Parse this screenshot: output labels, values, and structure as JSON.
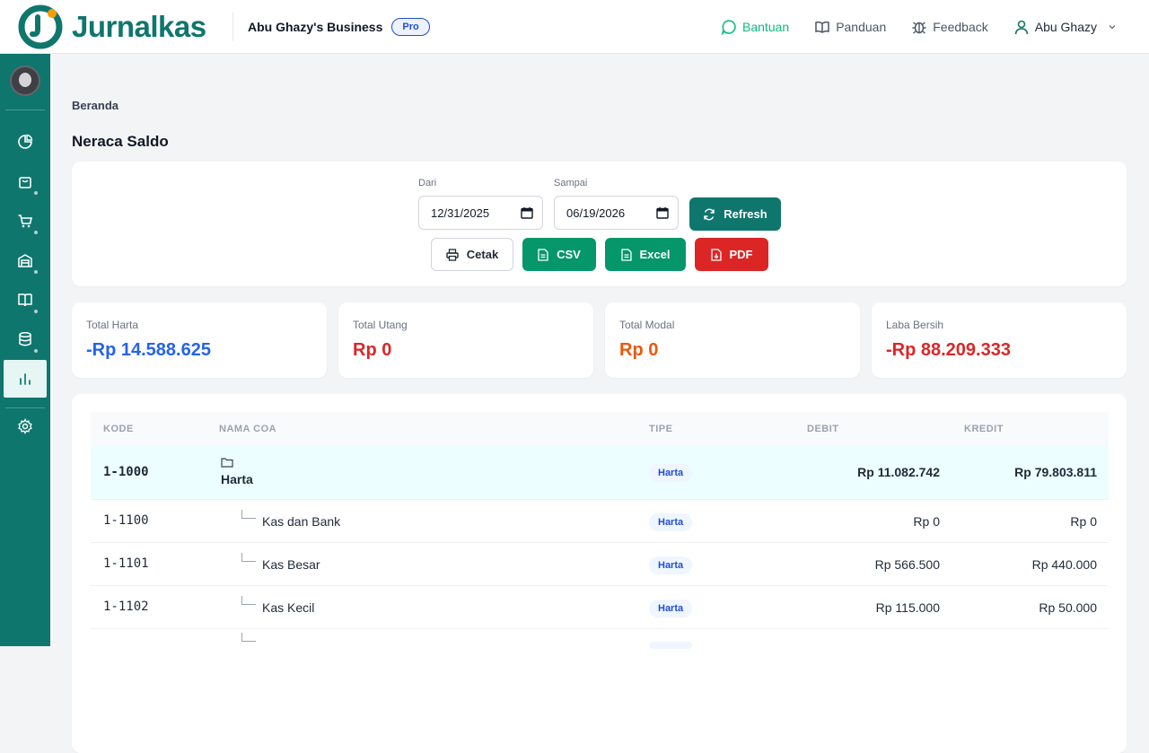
{
  "header": {
    "logo_text": "Jurnalkas",
    "business_name": "Abu Ghazy's Business",
    "plan_badge": "Pro",
    "links": {
      "help": "Bantuan",
      "guide": "Panduan",
      "feedback": "Feedback"
    },
    "user_name": "Abu Ghazy"
  },
  "colors": {
    "brand": "#0f766e",
    "help_link": "#10b981",
    "positive_blue": "#2563eb",
    "negative_red": "#dc2626",
    "orange": "#ea580c"
  },
  "sidebar": {
    "items": [
      {
        "icon": "pie-chart-icon",
        "active": false
      },
      {
        "icon": "shopping-bag-icon",
        "active": false
      },
      {
        "icon": "cart-icon",
        "active": false
      },
      {
        "icon": "warehouse-icon",
        "active": false
      },
      {
        "icon": "book-open-icon",
        "active": false
      },
      {
        "icon": "database-icon",
        "active": false
      },
      {
        "icon": "bar-chart-icon",
        "active": true
      },
      {
        "icon": "settings-icon",
        "active": false
      }
    ]
  },
  "breadcrumb": "Beranda",
  "page_title": "Neraca Saldo",
  "filter": {
    "from_label": "Dari",
    "from_value": "12/31/2025",
    "to_label": "Sampai",
    "to_value": "06/19/2026",
    "refresh_label": "Refresh",
    "print_label": "Cetak",
    "csv_label": "CSV",
    "excel_label": "Excel",
    "pdf_label": "PDF"
  },
  "stats": [
    {
      "label": "Total Harta",
      "value": "-Rp 14.588.625",
      "color": "#2563eb"
    },
    {
      "label": "Total Utang",
      "value": "Rp 0",
      "color": "#dc2626"
    },
    {
      "label": "Total Modal",
      "value": "Rp 0",
      "color": "#ea580c"
    },
    {
      "label": "Laba Bersih",
      "value": "-Rp 88.209.333",
      "color": "#dc2626"
    }
  ],
  "table": {
    "columns": {
      "code": "KODE",
      "name": "NAMA COA",
      "type": "TIPE",
      "debit": "DEBIT",
      "credit": "KREDIT"
    },
    "rows": [
      {
        "code": "1-1000",
        "name": "Harta",
        "type": "Harta",
        "debit": "Rp 11.082.742",
        "credit": "Rp 79.803.811",
        "group": true
      },
      {
        "code": "1-1100",
        "name": "Kas dan Bank",
        "type": "Harta",
        "debit": "Rp 0",
        "credit": "Rp 0",
        "group": false
      },
      {
        "code": "1-1101",
        "name": "Kas Besar",
        "type": "Harta",
        "debit": "Rp 566.500",
        "credit": "Rp 440.000",
        "group": false
      },
      {
        "code": "1-1102",
        "name": "Kas Kecil",
        "type": "Harta",
        "debit": "Rp 115.000",
        "credit": "Rp 50.000",
        "group": false
      }
    ]
  }
}
